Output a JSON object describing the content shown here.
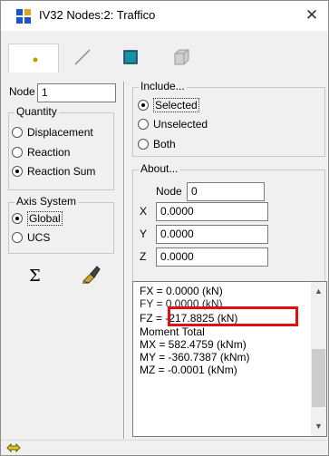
{
  "window": {
    "title": "IV32 Nodes:2: Traffico",
    "close_symbol": "✕"
  },
  "left": {
    "node_label": "Node",
    "node_value": "1",
    "quantity": {
      "title": "Quantity",
      "options": [
        {
          "label": "Displacement",
          "selected": false
        },
        {
          "label": "Reaction",
          "selected": false
        },
        {
          "label": "Reaction Sum",
          "selected": true
        }
      ]
    },
    "axis": {
      "title": "Axis System",
      "options": [
        {
          "label": "Global",
          "selected": true
        },
        {
          "label": "UCS",
          "selected": false
        }
      ]
    },
    "sigma_symbol": "Σ"
  },
  "include": {
    "title": "Include...",
    "options": [
      {
        "label": "Selected",
        "selected": true
      },
      {
        "label": "Unselected",
        "selected": false
      },
      {
        "label": "Both",
        "selected": false
      }
    ]
  },
  "about": {
    "title": "About...",
    "node_label": "Node",
    "node_value": "0",
    "coords": [
      {
        "label": "X",
        "value": "0.0000"
      },
      {
        "label": "Y",
        "value": "0.0000"
      },
      {
        "label": "Z",
        "value": "0.0000"
      }
    ]
  },
  "results": {
    "lines": [
      "FX  = 0.0000 (kN)",
      "FY  = 0.0000 (kN)",
      "FZ  = -217.8825 (kN)",
      "Moment Total",
      "MX  = 582.4759 (kNm)",
      "MY  = -360.7387 (kNm)",
      "MZ  = -0.0001 (kNm)"
    ],
    "highlighted_line": "FZ  = -217.8825 (kN)"
  },
  "colors": {
    "highlight": "#e01010",
    "accent": "#1a8fa8"
  },
  "icons": [
    "app-icon",
    "node-tool-icon",
    "line-tool-icon",
    "square-tool-icon",
    "cube-tool-icon",
    "sigma-icon",
    "eraser-icon",
    "move-arrows-icon",
    "close-icon"
  ]
}
